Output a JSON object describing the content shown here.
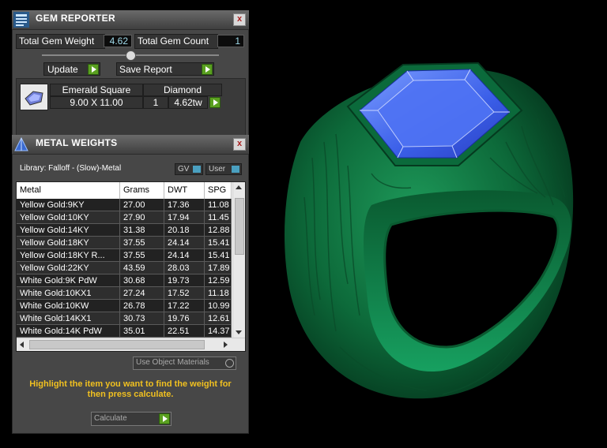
{
  "gem_reporter": {
    "title": "GEM REPORTER",
    "close": "x",
    "total_weight_label": "Total Gem Weight",
    "total_weight_value": "4.62",
    "total_count_label": "Total Gem Count",
    "total_count_value": "1",
    "update_label": "Update",
    "save_report_label": "Save Report",
    "gem": {
      "shape": "Emerald Square",
      "type": "Diamond",
      "size": "9.00 X 11.00",
      "qty": "1",
      "weight": "4.62tw"
    }
  },
  "metal_weights": {
    "title": "METAL WEIGHTS",
    "close": "x",
    "library_label": "Library: Falloff - (Slow)-Metal",
    "gv_label": "GV",
    "user_label": "User",
    "columns": [
      "Metal",
      "Grams",
      "DWT",
      "SPG"
    ],
    "rows": [
      [
        "Yellow Gold:9KY",
        "27.00",
        "17.36",
        "11.08"
      ],
      [
        "Yellow Gold:10KY",
        "27.90",
        "17.94",
        "11.45"
      ],
      [
        "Yellow Gold:14KY",
        "31.38",
        "20.18",
        "12.88"
      ],
      [
        "Yellow Gold:18KY",
        "37.55",
        "24.14",
        "15.41"
      ],
      [
        "Yellow Gold:18KY R...",
        "37.55",
        "24.14",
        "15.41"
      ],
      [
        "Yellow Gold:22KY",
        "43.59",
        "28.03",
        "17.89"
      ],
      [
        "White Gold:9K PdW",
        "30.68",
        "19.73",
        "12.59"
      ],
      [
        "White Gold:10KX1",
        "27.24",
        "17.52",
        "11.18"
      ],
      [
        "White Gold:10KW",
        "26.78",
        "17.22",
        "10.99"
      ],
      [
        "White Gold:14KX1",
        "30.73",
        "19.76",
        "12.61"
      ],
      [
        "White Gold:14K PdW",
        "35.01",
        "22.51",
        "14.37"
      ]
    ],
    "use_object_materials_label": "Use Object Materials",
    "hint": "Highlight the item you want to find the weight for then press calculate.",
    "calculate_label": "Calculate"
  },
  "colors": {
    "accent_green": "#5aa020",
    "hint_yellow": "#f0c020",
    "ring_green": "#0f7a45",
    "stone_blue": "#3a6cf0"
  }
}
